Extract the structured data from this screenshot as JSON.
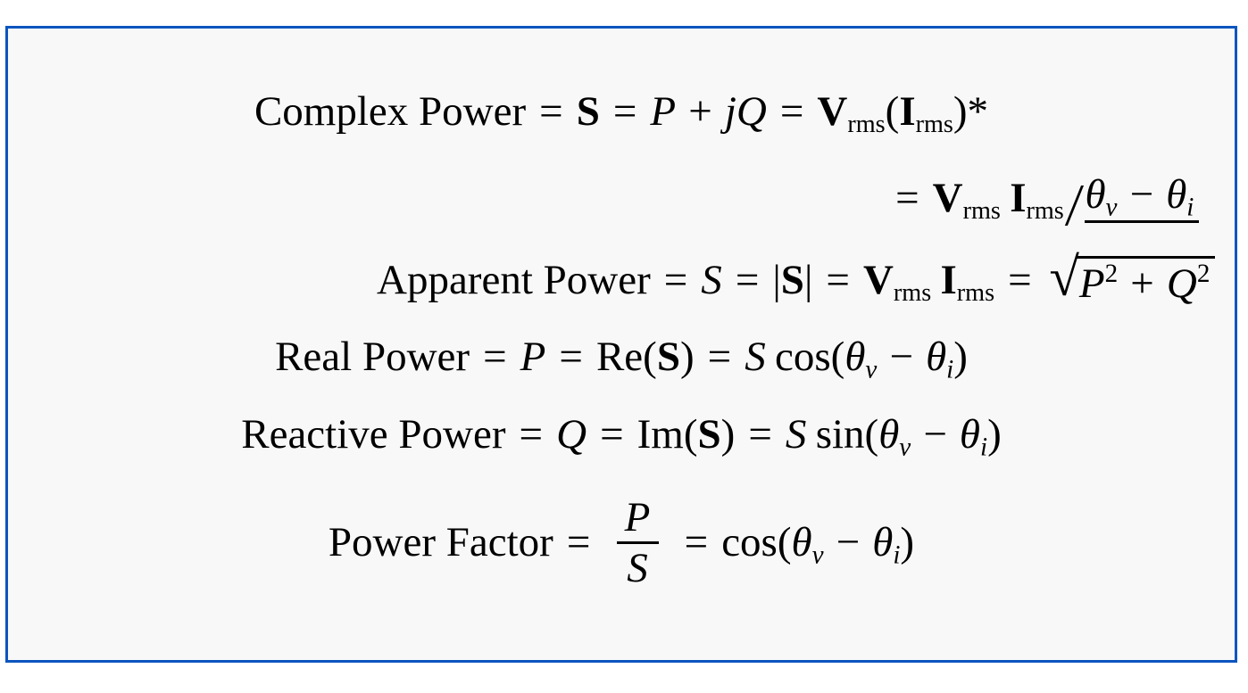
{
  "slide": {
    "background_color": "#f8f8f8",
    "page_color": "#ffffff",
    "border_color": "#0b55bf",
    "text_color": "#000000"
  },
  "equations": {
    "line1": {
      "label": "Complex Power",
      "eq1": "=",
      "sym_S_bold": "S",
      "eq2": "=",
      "P": "P",
      "plus": "+",
      "j": "j",
      "Q": "Q",
      "eq3": "=",
      "V": "V",
      "V_sub": "rms",
      "open_paren": "(",
      "I": "I",
      "I_sub": "rms",
      "close_paren": ")",
      "star": "*"
    },
    "line2": {
      "eq1": "=",
      "V": "V",
      "V_sub": "rms",
      "I": "I",
      "I_sub": "rms",
      "angle_symbol": "angle",
      "theta1": "θ",
      "theta1_sub": "v",
      "minus": "−",
      "theta2": "θ",
      "theta2_sub": "i"
    },
    "line3": {
      "label": "Apparent Power",
      "eq1": "=",
      "S_italic": "S",
      "eq2": "=",
      "abs_open": "|",
      "S_bold": "S",
      "abs_close": "|",
      "eq3": "=",
      "V": "V",
      "V_sub": "rms",
      "I": "I",
      "I_sub": "rms",
      "eq4": "=",
      "radical": "√",
      "P": "P",
      "P_exp": "2",
      "plus": "+",
      "Q": "Q",
      "Q_exp": "2"
    },
    "line4": {
      "label": "Real Power",
      "eq1": "=",
      "P": "P",
      "eq2": "=",
      "Re": "Re(",
      "S_bold": "S",
      "Re_close": ")",
      "eq3": "=",
      "S_italic": "S",
      "func": "cos(",
      "theta1": "θ",
      "theta1_sub": "v",
      "minus": "−",
      "theta2": "θ",
      "theta2_sub": "i",
      "func_close": ")"
    },
    "line5": {
      "label": "Reactive Power",
      "eq1": "=",
      "Q": "Q",
      "eq2": "=",
      "Im": "Im(",
      "S_bold": "S",
      "Im_close": ")",
      "eq3": "=",
      "S_italic": "S",
      "func": "sin(",
      "theta1": "θ",
      "theta1_sub": "v",
      "minus": "−",
      "theta2": "θ",
      "theta2_sub": "i",
      "func_close": ")"
    },
    "line6": {
      "label": "Power Factor",
      "eq1": "=",
      "numerator": "P",
      "denominator": "S",
      "eq2": "=",
      "func": "cos(",
      "theta1": "θ",
      "theta1_sub": "v",
      "minus": "−",
      "theta2": "θ",
      "theta2_sub": "i",
      "func_close": ")"
    }
  }
}
